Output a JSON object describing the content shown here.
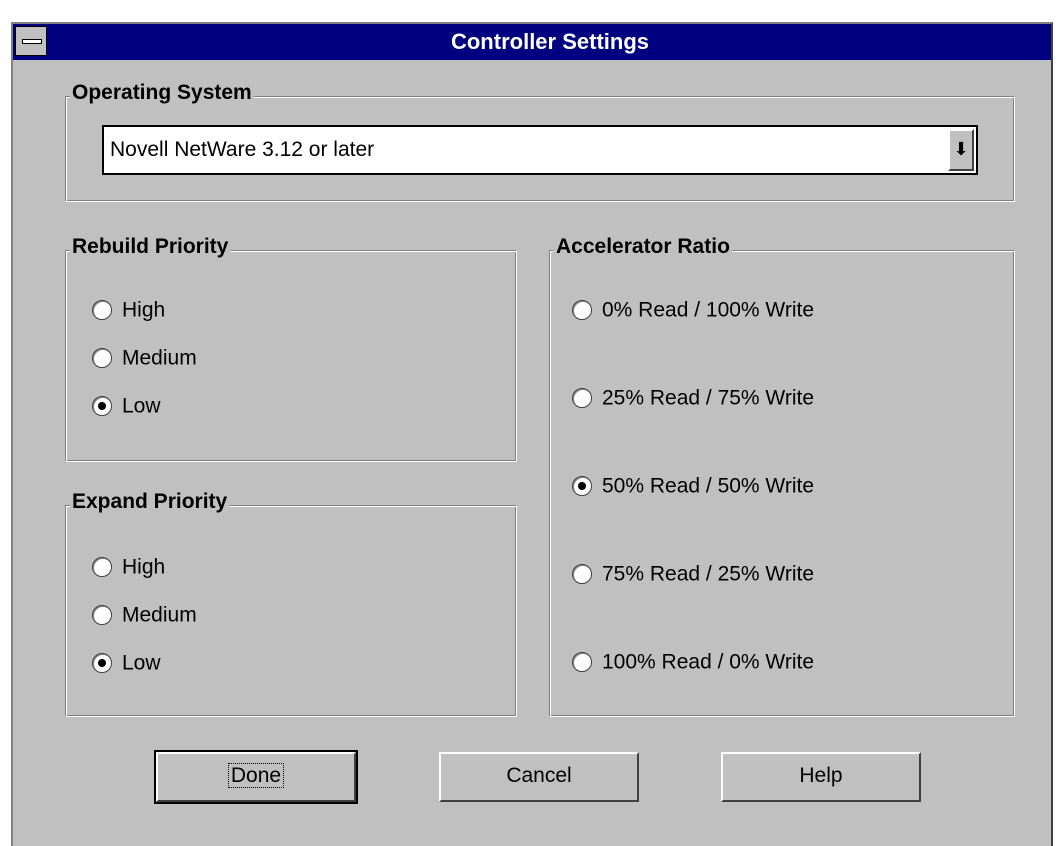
{
  "window": {
    "title": "Controller Settings"
  },
  "operating_system": {
    "label": "Operating System",
    "selected": "Novell NetWare 3.12 or later",
    "dropdown_icon": "arrow-down-icon"
  },
  "rebuild_priority": {
    "label": "Rebuild Priority",
    "options": [
      "High",
      "Medium",
      "Low"
    ],
    "selected": "Low"
  },
  "expand_priority": {
    "label": "Expand Priority",
    "options": [
      "High",
      "Medium",
      "Low"
    ],
    "selected": "Low"
  },
  "accelerator_ratio": {
    "label": "Accelerator Ratio",
    "options": [
      "0% Read / 100% Write",
      "25% Read / 75% Write",
      "50% Read / 50% Write",
      "75% Read / 25% Write",
      "100% Read / 0% Write"
    ],
    "selected": "50% Read / 50% Write"
  },
  "buttons": {
    "done": "Done",
    "cancel": "Cancel",
    "help": "Help"
  }
}
